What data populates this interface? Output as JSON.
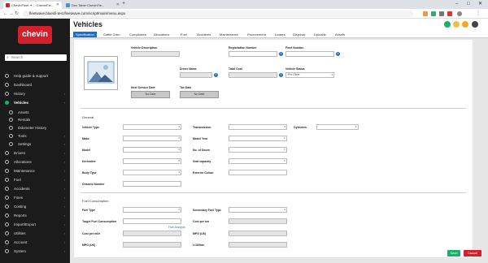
{
  "browser": {
    "tabs": [
      {
        "label": "ChevinFleet ✦ - ·ChevinFle...",
        "active": true,
        "color": "#d4202a"
      },
      {
        "label": "Dev Table·ChevinFle...",
        "active": false,
        "color": "#4a90d9"
      }
    ],
    "url": "fleetwave.bluesfi-test.fleetwave.com/script/main/menu.aspx"
  },
  "app": {
    "page_title": "Vehicles",
    "logo": "chevin"
  },
  "sidebar": {
    "search_placeholder": "Search",
    "items": [
      {
        "label": "Help guide & support",
        "chev": false
      },
      {
        "label": "Dashboard",
        "chev": false
      },
      {
        "label": "History",
        "chev": true
      },
      {
        "label": "Vehicles",
        "chev": true,
        "active": true
      },
      {
        "label": "Assets",
        "sub": true
      },
      {
        "label": "Rentals",
        "sub": true
      },
      {
        "label": "Odometer History",
        "sub": true
      },
      {
        "label": "Tools",
        "sub": true,
        "chev": true
      },
      {
        "label": "Settings",
        "sub": true,
        "chev": true
      },
      {
        "label": "Drivers",
        "chev": true
      },
      {
        "label": "Allocations",
        "chev": true
      },
      {
        "label": "Maintenance",
        "chev": true
      },
      {
        "label": "Fuel",
        "chev": true
      },
      {
        "label": "Accidents",
        "chev": true
      },
      {
        "label": "Fines",
        "chev": true
      },
      {
        "label": "Costing",
        "chev": true
      },
      {
        "label": "Reports",
        "chev": true
      },
      {
        "label": "Import/Export",
        "chev": true
      },
      {
        "label": "Utilities",
        "chev": true
      },
      {
        "label": "Account",
        "chev": true
      },
      {
        "label": "System",
        "chev": true
      }
    ]
  },
  "tabs": [
    "Specification",
    "Cattle Grbo",
    "Compliance",
    "Allocations",
    "Fuel",
    "Accidents",
    "Maintenance",
    "Procurement",
    "Leases",
    "Disposal",
    "Uploads",
    "Assets"
  ],
  "header": {
    "vehicle_description": "Vehicle Description",
    "registration_number": "Registration Number",
    "fleet_number": "Fleet Number",
    "driver_name": "Driver Name",
    "total_cost": "Total Cost",
    "vehicle_status": "Vehicle Status",
    "vehicle_status_value": "Pre-Fleet",
    "next_service_date": "Next Service Date",
    "tax_date": "Tax Date",
    "no_date_1": "No Date",
    "no_date_2": "No Date"
  },
  "general": {
    "title": "General",
    "vehicle_type": "Vehicle Type",
    "make": "Make",
    "model": "Model",
    "derivative": "Derivative",
    "body_type": "Body Type",
    "chassis_number": "Chassis Number",
    "transmission": "Transmission",
    "model_year": "Model Year",
    "no_of_doors": "No. of Doors",
    "seat_capacity": "Seat capacity",
    "exterior_colour": "Exterior Colour",
    "cylinders": "Cylinders"
  },
  "fuel": {
    "title": "Fuel Consumption",
    "fuel_type": "Fuel Type",
    "target_fuel_consumption": "Target Fuel Consumption",
    "fuel_analysis": "Fuel Analysis",
    "cost_per_mile": "Cost per mile",
    "mpg_uk": "MPG (UK)",
    "secondary_fuel_type": "Secondary Fuel Type",
    "cost_per_km": "Cost per km",
    "mpg_us": "MPG (US)",
    "l_100km": "L/100km"
  },
  "actions": {
    "save": "Save",
    "cancel": "Cancel"
  },
  "colors": {
    "accent": "#1a6fc7",
    "brand": "#d4202a",
    "save": "#17b169"
  }
}
